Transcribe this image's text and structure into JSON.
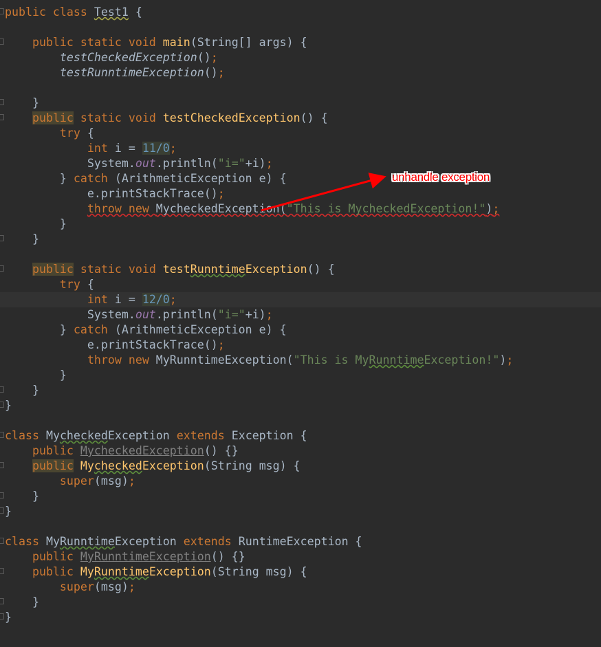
{
  "editor": {
    "current_line": 19,
    "fold_lines": [
      0,
      2,
      6,
      7,
      15,
      17,
      25,
      26,
      28,
      30,
      32,
      33,
      35,
      37,
      39,
      40
    ],
    "lines": [
      [
        [
          "public class ",
          "kw"
        ],
        [
          "Test1",
          "def warn"
        ],
        [
          " {",
          "def"
        ]
      ],
      [],
      [
        [
          "    public static void ",
          "kw"
        ],
        [
          "main",
          "mdecl"
        ],
        [
          "(String[] args) {",
          "def"
        ]
      ],
      [
        [
          "        ",
          "def"
        ],
        [
          "testCheckedException",
          "def scall"
        ],
        [
          "()",
          "def"
        ],
        [
          ";",
          "kw"
        ]
      ],
      [
        [
          "        ",
          "def"
        ],
        [
          "testRunntimeException",
          "def scall"
        ],
        [
          "()",
          "def"
        ],
        [
          ";",
          "kw"
        ]
      ],
      [],
      [
        [
          "    }",
          "def"
        ]
      ],
      [
        [
          "    ",
          "def"
        ],
        [
          "public",
          "kw hl"
        ],
        [
          " static void ",
          "kw"
        ],
        [
          "testCheckedException",
          "mdecl"
        ],
        [
          "() {",
          "def"
        ]
      ],
      [
        [
          "        try",
          "kw"
        ],
        [
          " {",
          "def"
        ]
      ],
      [
        [
          "            int ",
          "kw"
        ],
        [
          "i = ",
          "def"
        ],
        [
          "11/0",
          "num"
        ],
        [
          ";",
          "kw"
        ]
      ],
      [
        [
          "            System.",
          "def"
        ],
        [
          "out",
          "field"
        ],
        [
          ".println(",
          "def"
        ],
        [
          "\"i=\"",
          "str"
        ],
        [
          "+i)",
          "def"
        ],
        [
          ";",
          "kw"
        ]
      ],
      [
        [
          "        } ",
          "def"
        ],
        [
          "catch",
          "kw"
        ],
        [
          " (ArithmeticException e) {",
          "def"
        ]
      ],
      [
        [
          "            e.printStackTrace()",
          "def"
        ],
        [
          ";",
          "kw"
        ]
      ],
      [
        [
          "            ",
          "def"
        ],
        [
          "throw new ",
          "kw err"
        ],
        [
          "MycheckedException(",
          "def err"
        ],
        [
          "\"This is MycheckedException!\"",
          "str err"
        ],
        [
          ")",
          "def err"
        ],
        [
          ";",
          "kw err"
        ]
      ],
      [
        [
          "        }",
          "def"
        ]
      ],
      [
        [
          "    }",
          "def"
        ]
      ],
      [],
      [
        [
          "    ",
          "def"
        ],
        [
          "public",
          "kw hl"
        ],
        [
          " static void ",
          "kw"
        ],
        [
          "test",
          "mdecl"
        ],
        [
          "Runntime",
          "mdecl typo"
        ],
        [
          "Exception",
          "mdecl"
        ],
        [
          "() {",
          "def"
        ]
      ],
      [
        [
          "        try",
          "kw"
        ],
        [
          " {",
          "def"
        ]
      ],
      [
        [
          "            int ",
          "kw"
        ],
        [
          "i = ",
          "def"
        ],
        [
          "12/0",
          "num"
        ],
        [
          ";",
          "kw"
        ]
      ],
      [
        [
          "            System.",
          "def"
        ],
        [
          "out",
          "field"
        ],
        [
          ".println(",
          "def"
        ],
        [
          "\"i=\"",
          "str"
        ],
        [
          "+i)",
          "def"
        ],
        [
          ";",
          "kw"
        ]
      ],
      [
        [
          "        } ",
          "def"
        ],
        [
          "catch",
          "kw"
        ],
        [
          " (ArithmeticException e) {",
          "def"
        ]
      ],
      [
        [
          "            e.printStackTrace()",
          "def"
        ],
        [
          ";",
          "kw"
        ]
      ],
      [
        [
          "            ",
          "def"
        ],
        [
          "throw new ",
          "kw"
        ],
        [
          "MyRunntimeException(",
          "def"
        ],
        [
          "\"This is My",
          "str"
        ],
        [
          "Runntime",
          "str typo"
        ],
        [
          "Exception!\"",
          "str"
        ],
        [
          ")",
          "def"
        ],
        [
          ";",
          "kw"
        ]
      ],
      [
        [
          "        }",
          "def"
        ]
      ],
      [
        [
          "    }",
          "def"
        ]
      ],
      [
        [
          "}",
          "def"
        ]
      ],
      [],
      [
        [
          "class ",
          "kw"
        ],
        [
          "My",
          "def"
        ],
        [
          "checked",
          "def typo"
        ],
        [
          "Exception ",
          "def"
        ],
        [
          "extends ",
          "kw"
        ],
        [
          "Exception {",
          "def"
        ]
      ],
      [
        [
          "    public ",
          "kw"
        ],
        [
          "MycheckedException",
          "unused"
        ],
        [
          "() {}",
          "def"
        ]
      ],
      [
        [
          "    ",
          "def"
        ],
        [
          "public",
          "kw hl"
        ],
        [
          " ",
          "def"
        ],
        [
          "My",
          "mdecl"
        ],
        [
          "checked",
          "mdecl typo"
        ],
        [
          "Exception",
          "mdecl"
        ],
        [
          "(String msg) {",
          "def"
        ]
      ],
      [
        [
          "        super",
          "kw"
        ],
        [
          "(msg)",
          "def"
        ],
        [
          ";",
          "kw"
        ]
      ],
      [
        [
          "    }",
          "def"
        ]
      ],
      [
        [
          "}",
          "def"
        ]
      ],
      [],
      [
        [
          "class ",
          "kw"
        ],
        [
          "My",
          "def"
        ],
        [
          "Runntime",
          "def typo"
        ],
        [
          "Exception ",
          "def"
        ],
        [
          "extends ",
          "kw"
        ],
        [
          "RuntimeException {",
          "def"
        ]
      ],
      [
        [
          "    public ",
          "kw"
        ],
        [
          "MyRunntimeException",
          "unused"
        ],
        [
          "() {}",
          "def"
        ]
      ],
      [
        [
          "    public ",
          "kw"
        ],
        [
          "My",
          "mdecl"
        ],
        [
          "Runntime",
          "mdecl typo"
        ],
        [
          "Exception",
          "mdecl"
        ],
        [
          "(String msg) {",
          "def"
        ]
      ],
      [
        [
          "        super",
          "kw"
        ],
        [
          "(msg)",
          "def"
        ],
        [
          ";",
          "kw"
        ]
      ],
      [
        [
          "    }",
          "def"
        ]
      ],
      [
        [
          "}",
          "def"
        ]
      ]
    ]
  },
  "annotation": {
    "text": "unhandle exception",
    "color": "#ff0000"
  },
  "colors": {
    "background": "#2b2b2b",
    "keyword": "#cc7832",
    "text": "#a9b7c6",
    "method": "#ffc66d",
    "string": "#6a8759",
    "number": "#6897bb",
    "field": "#9876aa"
  }
}
